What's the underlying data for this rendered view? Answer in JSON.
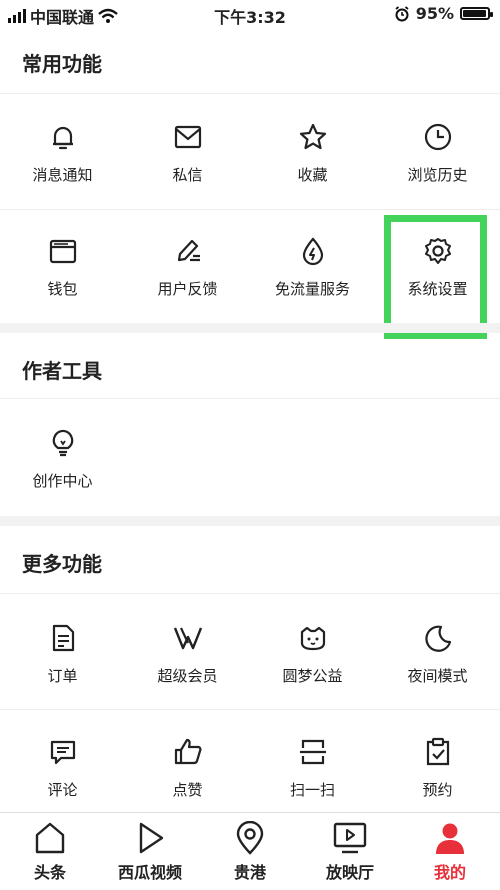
{
  "status_bar": {
    "carrier": "中国联通",
    "time": "下午3:32",
    "battery": "95%"
  },
  "sections": {
    "common": {
      "title": "常用功能",
      "items": [
        "消息通知",
        "私信",
        "收藏",
        "浏览历史",
        "钱包",
        "用户反馈",
        "免流量服务",
        "系统设置"
      ]
    },
    "author": {
      "title": "作者工具",
      "items": [
        "创作中心"
      ]
    },
    "more": {
      "title": "更多功能",
      "items": [
        "订单",
        "超级会员",
        "圆梦公益",
        "夜间模式",
        "评论",
        "点赞",
        "扫一扫",
        "预约"
      ]
    }
  },
  "tabbar": {
    "items": [
      "头条",
      "西瓜视频",
      "贵港",
      "放映厅",
      "我的"
    ],
    "active_index": 4,
    "active_color": "#e8303a"
  },
  "highlight_color": "#43d35a",
  "icons": [
    "bell-icon",
    "mail-icon",
    "star-icon",
    "clock-icon",
    "wallet-icon",
    "pencil-icon",
    "drop-bolt-icon",
    "gear-icon",
    "bulb-icon",
    "doc-icon",
    "v-logo-icon",
    "cat-face-icon",
    "moon-icon",
    "comment-icon",
    "thumb-up-icon",
    "scan-icon",
    "clipboard-check-icon",
    "home-icon",
    "play-icon",
    "location-icon",
    "tv-play-icon",
    "user-icon"
  ]
}
